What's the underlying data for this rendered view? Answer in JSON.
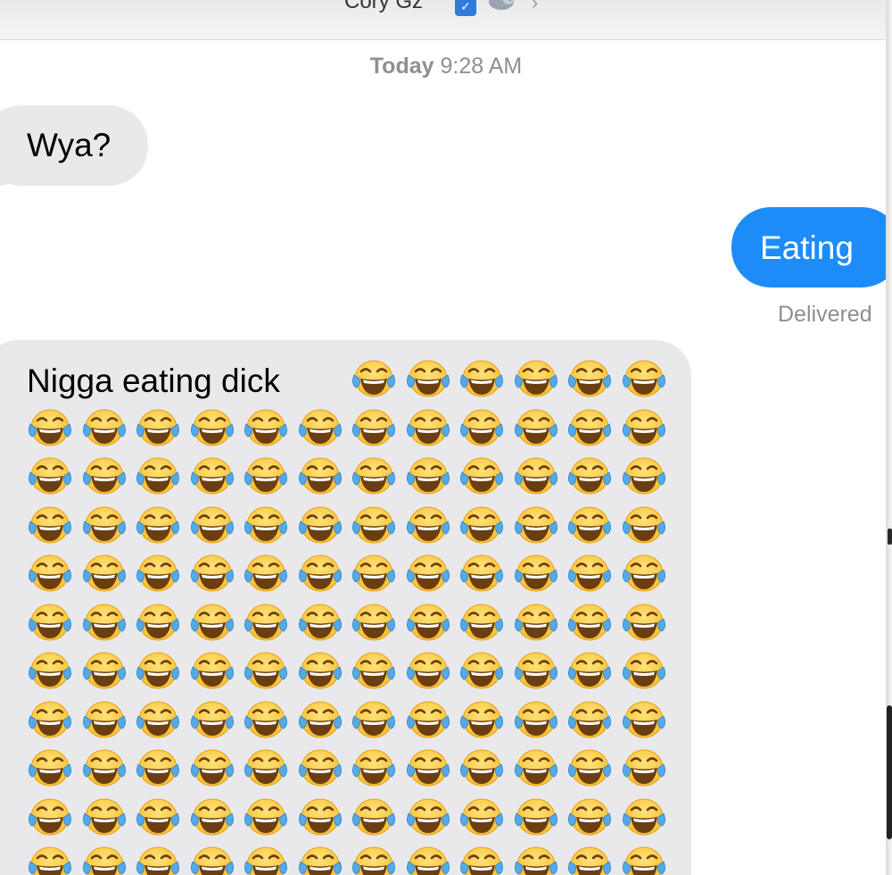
{
  "header": {
    "contact_name": "Cory Gz",
    "verified_icon": "verified-badge-icon",
    "bird_icon": "bird-icon",
    "chevron": "›"
  },
  "conversation": {
    "timestamp_day": "Today",
    "timestamp_time": "9:28 AM",
    "messages": [
      {
        "direction": "incoming",
        "text": "Wya?"
      },
      {
        "direction": "outgoing",
        "text": "Eating",
        "status": "Delivered"
      },
      {
        "direction": "incoming",
        "text": "Nigga eating dick",
        "emoji": "face-with-tears-of-joy",
        "emoji_count": 126
      }
    ]
  },
  "colors": {
    "incoming_bubble": "#e9e9eb",
    "outgoing_bubble": "#1d8cf8",
    "meta_text": "#8e8e93",
    "emoji_face": "#fbbf2e",
    "emoji_tear": "#54a9e6"
  }
}
